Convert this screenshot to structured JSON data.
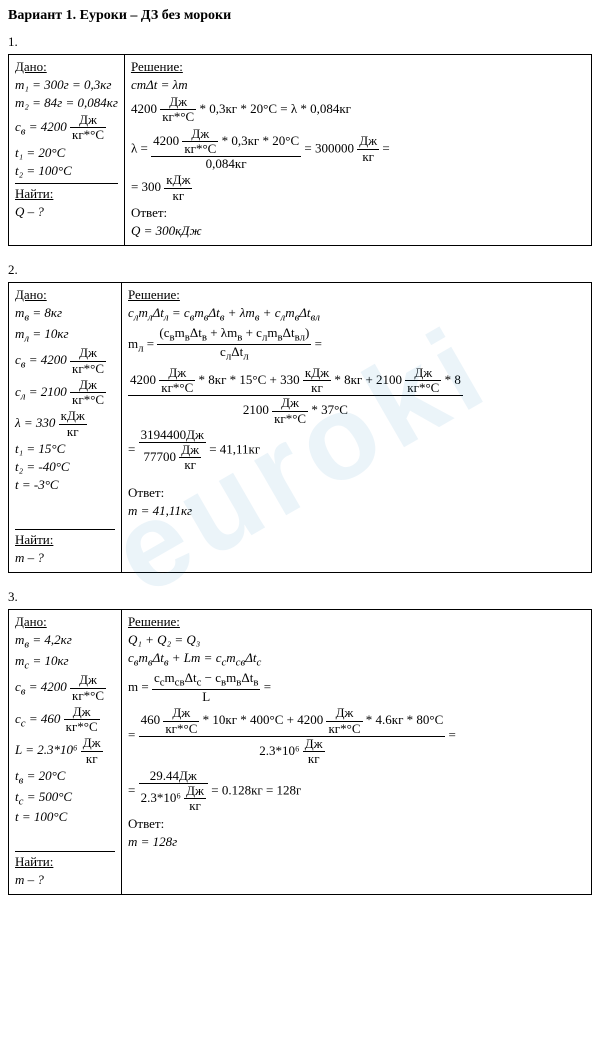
{
  "header": "Вариант 1. Еуроки – ДЗ без мороки",
  "labels": {
    "given": "Дано:",
    "find": "Найти:",
    "solution": "Решение:",
    "answer": "Ответ:"
  },
  "p1": {
    "num": "1.",
    "given": {
      "m1": "m₁ = 300г = 0,3кг",
      "m2": "m₂ = 84г = 0,084кг",
      "cv_left": "c<sub>в</sub> = 4200",
      "cv_frac_n": "Дж",
      "cv_frac_d": "кг*°C",
      "t1": "t₁ = 20°C",
      "t2": "t₂ = 100°C",
      "find": "Q – ?"
    },
    "solution": {
      "eq1": "cmΔt = λm",
      "eq2_l": "4200",
      "eq2_fn": "Дж",
      "eq2_fd": "кг*°C",
      "eq2_r": "* 0,3кг * 20°C = λ * 0,084кг",
      "eq3_pre": "λ =",
      "eq3_num_l": "4200",
      "eq3_num_fn": "Дж",
      "eq3_num_fd": "кг*°C",
      "eq3_num_r": "* 0,3кг * 20°C",
      "eq3_den": "0,084кг",
      "eq3_res_l": "= 300000",
      "eq3_res_fn": "Дж",
      "eq3_res_fd": "кг",
      "eq3_res_r": "=",
      "eq4_l": "= 300",
      "eq4_fn": "кДж",
      "eq4_fd": "кг",
      "ans": "Q = 300кДж"
    }
  },
  "p2": {
    "num": "2.",
    "given": {
      "mv": "m<sub>в</sub> = 8кг",
      "ml": "m<sub>л</sub> = 10кг",
      "cv_l": "c<sub>в</sub> = 4200",
      "cv_fn": "Дж",
      "cv_fd": "кг*°C",
      "cl_l": "c<sub>л</sub> = 2100",
      "cl_fn": "Дж",
      "cl_fd": "кг*°C",
      "lam_l": "λ = 330",
      "lam_fn": "кДж",
      "lam_fd": "кг",
      "t1": "t₁ = 15°C",
      "t2": "t₂ = -40°C",
      "t": "t = -3°C",
      "find": "m – ?"
    },
    "solution": {
      "eq1": "c<sub>л</sub>m<sub>л</sub>Δt<sub>л</sub> = c<sub>в</sub>m<sub>в</sub>Δt<sub>в</sub> + λm<sub>в</sub> + c<sub>л</sub>m<sub>в</sub>Δt<sub>вл</sub>",
      "eq2_pre": "m<sub>л</sub> =",
      "eq2_num": "(c<sub>в</sub>m<sub>в</sub>Δt<sub>в</sub> + λm<sub>в</sub> + c<sub>л</sub>m<sub>в</sub>Δt<sub>вл</sub>)",
      "eq2_den": "c<sub>л</sub>Δt<sub>л</sub>",
      "eq2_post": "=",
      "eq3_num_1l": "4200",
      "eq3_num_1fn": "Дж",
      "eq3_num_1fd": "кг*°C",
      "eq3_num_1r": "* 8кг * 15°C + 330",
      "eq3_num_2fn": "кДж",
      "eq3_num_2fd": "кг",
      "eq3_num_2r": "* 8кг + 2100",
      "eq3_num_3fn": "Дж",
      "eq3_num_3fd": "кг*°C",
      "eq3_num_3r": "* 8",
      "eq3_den_l": "2100",
      "eq3_den_fn": "Дж",
      "eq3_den_fd": "кг*°C",
      "eq3_den_r": "* 37°C",
      "eq4_pre": "=",
      "eq4_num": "3194400Дж",
      "eq4_den_l": "77700",
      "eq4_den_fn": "Дж",
      "eq4_den_fd": "кг",
      "eq4_post": "= 41,11кг",
      "ans": "m = 41,11кг"
    }
  },
  "p3": {
    "num": "3.",
    "given": {
      "mv": "m<sub>в</sub> = 4,2кг",
      "mc": "m<sub>c</sub> = 10кг",
      "cv_l": "c<sub>в</sub> = 4200",
      "cv_fn": "Дж",
      "cv_fd": "кг*°C",
      "cc_l": "c<sub>c</sub> = 460",
      "cc_fn": "Дж",
      "cc_fd": "кг*°C",
      "L_l": "L = 2.3*10⁶",
      "L_fn": "Дж",
      "L_fd": "кг",
      "tv": "t<sub>в</sub> = 20°C",
      "tc": "t<sub>c</sub> = 500°C",
      "t": "t = 100°C",
      "find": "m – ?"
    },
    "solution": {
      "eq1": "Q₁ + Q₂ = Q₃",
      "eq2": "c<sub>в</sub>m<sub>в</sub>Δt<sub>в</sub> + Lm = c<sub>c</sub>m<sub>cв</sub>Δt<sub>c</sub>",
      "eq3_pre": "m =",
      "eq3_num": "c<sub>c</sub>m<sub>cв</sub>Δt<sub>c</sub> − c<sub>в</sub>m<sub>в</sub>Δt<sub>в</sub>",
      "eq3_den": "L",
      "eq3_post": "=",
      "eq4_num_1l": "460",
      "eq4_num_1fn": "Дж",
      "eq4_num_1fd": "кг*°C",
      "eq4_num_1r": "* 10кг * 400°C + 4200",
      "eq4_num_2fn": "Дж",
      "eq4_num_2fd": "кг*°C",
      "eq4_num_2r": "* 4.6кг * 80°C",
      "eq4_den_l": "2.3*10⁶",
      "eq4_den_fn": "Дж",
      "eq4_den_fd": "кг",
      "eq4_post": "=",
      "eq5_pre": "=",
      "eq5_num": "29.44Дж",
      "eq5_den_l": "2.3*10⁶",
      "eq5_den_fn": "Дж",
      "eq5_den_fd": "кг",
      "eq5_post": "= 0.128кг = 128г",
      "ans": "m = 128г"
    }
  }
}
